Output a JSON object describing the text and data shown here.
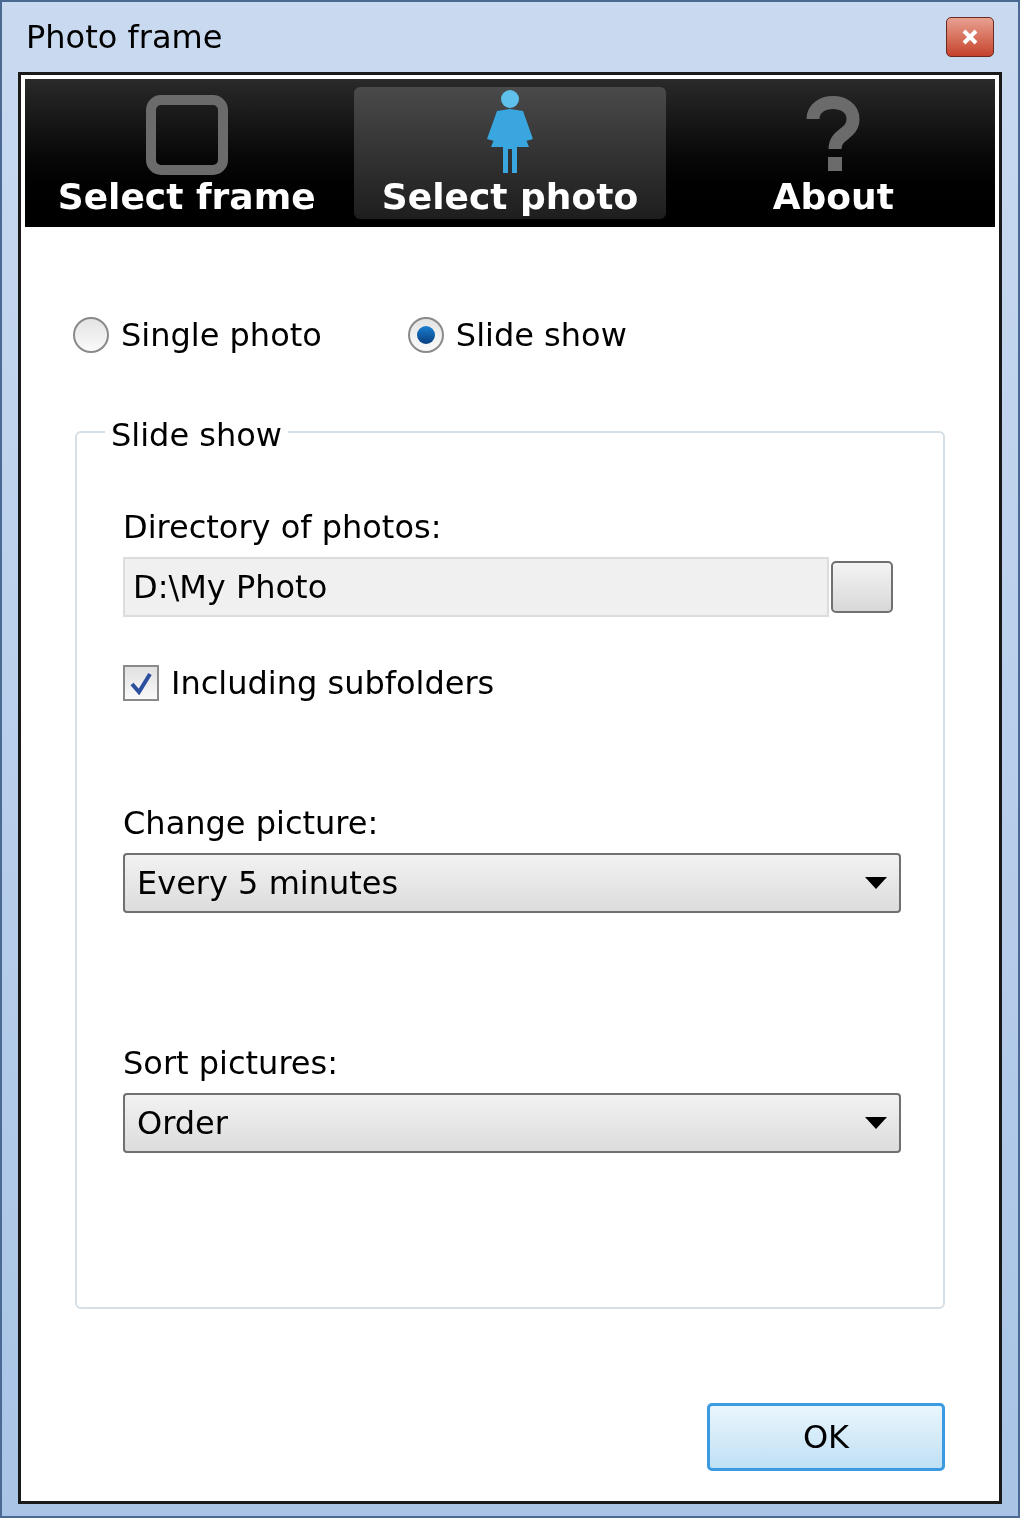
{
  "window": {
    "title": "Photo frame"
  },
  "tabs": [
    {
      "label": "Select frame",
      "selected": false,
      "kind": "frame"
    },
    {
      "label": "Select photo",
      "selected": true,
      "kind": "photo"
    },
    {
      "label": "About",
      "selected": false,
      "kind": "about"
    }
  ],
  "mode_options": [
    {
      "label": "Single photo",
      "selected": false
    },
    {
      "label": "Slide show",
      "selected": true
    }
  ],
  "slide_show": {
    "title": "Slide show",
    "directory": {
      "label": "Directory of photos:",
      "value": "D:\\My Photo"
    },
    "subfolders": {
      "label": "Including subfolders",
      "checked": true
    },
    "change_picture": {
      "label": "Change picture:",
      "value": "Every 5 minutes"
    },
    "sort_pictures": {
      "label": "Sort pictures:",
      "value": "Order"
    }
  },
  "buttons": [
    {
      "label": "OK"
    }
  ]
}
